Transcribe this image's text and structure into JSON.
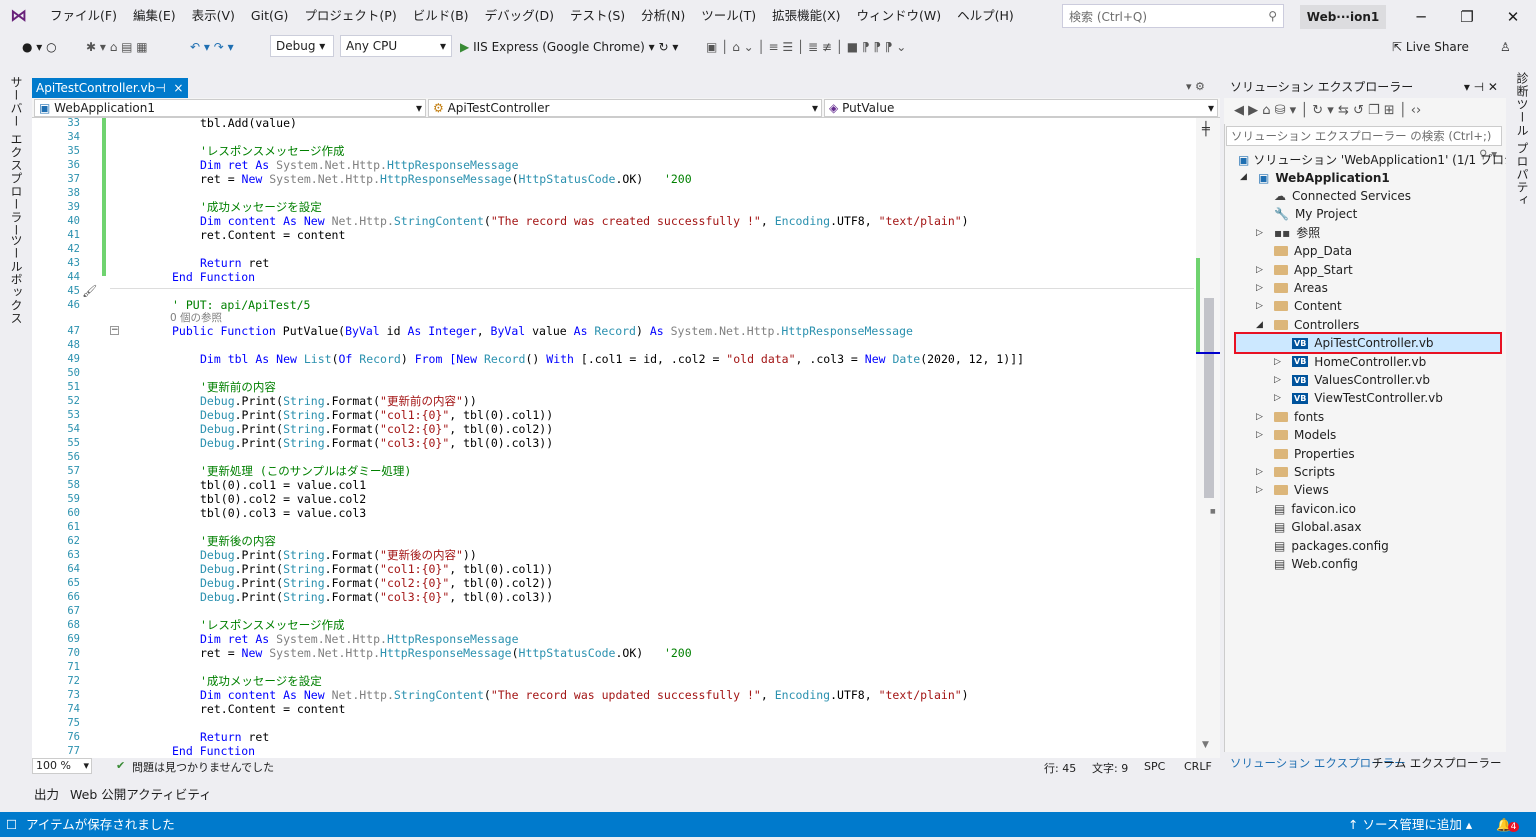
{
  "menu": {
    "items": [
      "ファイル(F)",
      "編集(E)",
      "表示(V)",
      "Git(G)",
      "プロジェクト(P)",
      "ビルド(B)",
      "デバッグ(D)",
      "テスト(S)",
      "分析(N)",
      "ツール(T)",
      "拡張機能(X)",
      "ウィンドウ(W)",
      "ヘルプ(H)"
    ],
    "search_placeholder": "検索 (Ctrl+Q)",
    "window_title": "Web···ion1"
  },
  "toolbar": {
    "config": "Debug",
    "platform": "Any CPU",
    "run_label": "IIS Express (Google Chrome)",
    "live_share": "Live Share"
  },
  "left_tabs": [
    "サーバー エクスプローラー",
    "ツールボックス"
  ],
  "right_tabs": [
    "診断ツール",
    "プロパティ"
  ],
  "doc_tab": {
    "label": "ApiTestController.vb",
    "pin": "⊣",
    "close": "×"
  },
  "nav": {
    "project": "WebApplication1",
    "class": "ApiTestController",
    "member": "PutValue"
  },
  "code": {
    "line_numbers": [
      "33",
      "34",
      "35",
      "36",
      "37",
      "38",
      "39",
      "40",
      "41",
      "42",
      "43",
      "44",
      "45",
      "46",
      "47",
      "48",
      "49",
      "50",
      "51",
      "52",
      "53",
      "54",
      "55",
      "56",
      "57",
      "58",
      "59",
      "60",
      "61",
      "62",
      "63",
      "64",
      "65",
      "66",
      "67",
      "68",
      "69",
      "70",
      "71",
      "72",
      "73",
      "74",
      "75",
      "76",
      "77"
    ],
    "ref_count": "0 個の参照",
    "l33": "tbl.Add(value)",
    "l35": "'レスポンスメッセージ作成",
    "l36a": "Dim ret As ",
    "l36b": "System.Net.Http.",
    "l36c": "HttpResponseMessage",
    "l37a": "ret = ",
    "l37b": "New ",
    "l37c": "System.Net.Http.",
    "l37d": "HttpResponseMessage",
    "l37e": "(",
    "l37f": "HttpStatusCode",
    "l37g": ".OK)   ",
    "l37h": "'200",
    "l39": "'成功メッセージを設定",
    "l40a": "Dim content As New ",
    "l40b": "Net.Http.",
    "l40c": "StringContent",
    "l40d": "(",
    "l40e": "\"The record was created successfully !\"",
    "l40f": ", ",
    "l40g": "Encoding",
    "l40h": ".UTF8, ",
    "l40i": "\"text/plain\"",
    "l40j": ")",
    "l41": "ret.Content = content",
    "l43a": "Return ",
    "l43b": "ret",
    "l44": "End Function",
    "l46": "' PUT: api/ApiTest/5",
    "l47a": "Public Function ",
    "l47b": "PutValue",
    "l47c": "(",
    "l47d": "ByVal ",
    "l47e": "id ",
    "l47f": "As Integer",
    "l47g": ", ",
    "l47h": "ByVal ",
    "l47i": "value ",
    "l47j": "As ",
    "l47k": "Record",
    "l47l": ") ",
    "l47m": "As ",
    "l47n": "System.Net.Http.",
    "l47o": "HttpResponseMessage",
    "l49a": "Dim tbl As New ",
    "l49b": "List",
    "l49c": "(",
    "l49d": "Of ",
    "l49e": "Record",
    "l49f": ") ",
    "l49g": "From ",
    "l49h": "[New ",
    "l49i": "Record",
    "l49j": "() ",
    "l49k": "With ",
    "l49l": "[.col1 = id, .col2 = ",
    "l49m": "\"old data\"",
    "l49n": ", .col3 = ",
    "l49o": "New ",
    "l49p": "Date",
    "l49q": "(2020, 12, 1)]]",
    "l51": "'更新前の内容",
    "l52a": "Debug",
    "l52b": ".Print(",
    "l52c": "String",
    "l52d": ".Format(",
    "l52e": "\"更新前の内容\"",
    "l52f": "))",
    "l53e": "\"col1:{0}\"",
    "l53f": ", tbl(0).col1))",
    "l54e": "\"col2:{0}\"",
    "l54f": ", tbl(0).col2))",
    "l55e": "\"col3:{0}\"",
    "l55f": ", tbl(0).col3))",
    "l57": "'更新処理 (このサンプルはダミー処理)",
    "l58": "tbl(0).col1 = value.col1",
    "l59": "tbl(0).col2 = value.col2",
    "l60": "tbl(0).col3 = value.col3",
    "l62": "'更新後の内容",
    "l63e": "\"更新後の内容\"",
    "l72": "'成功メッセージを設定",
    "l73e": "\"The record was updated successfully !\"",
    "l77": "End Function"
  },
  "editor_status": {
    "zoom": "100 %",
    "issues": "問題は見つかりませんでした",
    "line": "行: 45",
    "char": "文字: 9",
    "spc": "SPC",
    "crlf": "CRLF"
  },
  "output_tabs": [
    "出力",
    "Web 公開アクティビティ"
  ],
  "statusbar": {
    "saved": "アイテムが保存されました",
    "source_control": "ソース管理に追加",
    "badge": "4"
  },
  "solution_explorer": {
    "title": "ソリューション エクスプローラー",
    "search_placeholder": "ソリューション エクスプローラー の検索 (Ctrl+;)",
    "solution": "ソリューション 'WebApplication1' (1/1 プロジェクト)",
    "project": "WebApplication1",
    "items": [
      {
        "label": "Connected Services"
      },
      {
        "label": "My Project"
      },
      {
        "label": "参照"
      },
      {
        "label": "App_Data"
      },
      {
        "label": "App_Start"
      },
      {
        "label": "Areas"
      },
      {
        "label": "Content"
      },
      {
        "label": "Controllers"
      },
      {
        "label": "ApiTestController.vb"
      },
      {
        "label": "HomeController.vb"
      },
      {
        "label": "ValuesController.vb"
      },
      {
        "label": "ViewTestController.vb"
      },
      {
        "label": "fonts"
      },
      {
        "label": "Models"
      },
      {
        "label": "Properties"
      },
      {
        "label": "Scripts"
      },
      {
        "label": "Views"
      },
      {
        "label": "favicon.ico"
      },
      {
        "label": "Global.asax"
      },
      {
        "label": "packages.config"
      },
      {
        "label": "Web.config"
      }
    ],
    "bottom_tabs": [
      "ソリューション エクスプローラー",
      "チーム エクスプローラー"
    ]
  }
}
